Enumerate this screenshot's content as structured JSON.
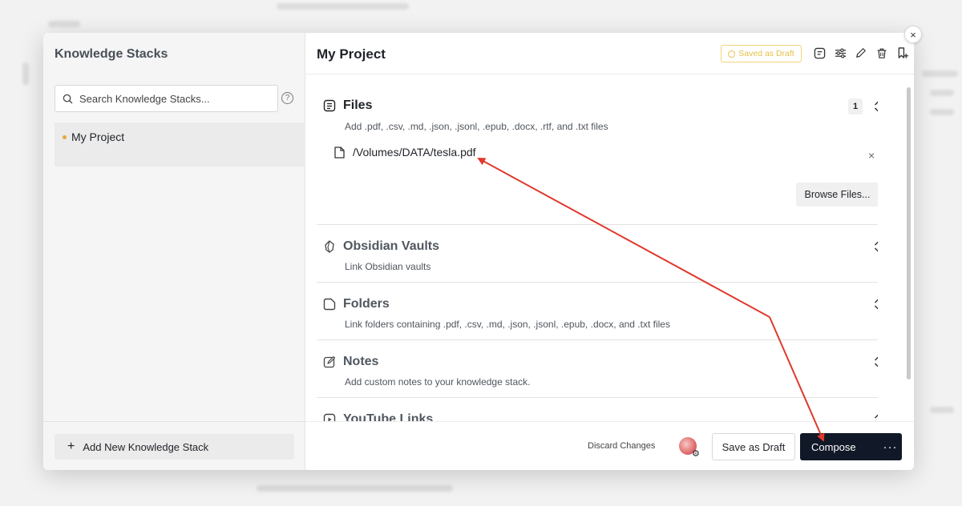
{
  "sidebar": {
    "title": "Knowledge Stacks",
    "search_placeholder": "Search Knowledge Stacks...",
    "help": "?",
    "items": [
      {
        "label": "My Project"
      }
    ],
    "add_button": "Add New Knowledge Stack"
  },
  "header": {
    "project_title": "My Project",
    "status_badge": "Saved as Draft"
  },
  "sections": {
    "files": {
      "title": "Files",
      "description": "Add .pdf, .csv, .md, .json, .jsonl, .epub, .docx, .rtf, and .txt files",
      "count": "1",
      "items": [
        {
          "path": "/Volumes/DATA/tesla.pdf"
        }
      ],
      "remove": "×",
      "browse_button": "Browse Files..."
    },
    "obsidian": {
      "title": "Obsidian Vaults",
      "description": "Link Obsidian vaults"
    },
    "folders": {
      "title": "Folders",
      "description": "Link folders containing .pdf, .csv, .md, .json, .jsonl, .epub, .docx, and .txt files"
    },
    "notes": {
      "title": "Notes",
      "description": "Add custom notes to your knowledge stack."
    },
    "youtube": {
      "title": "YouTube Links"
    }
  },
  "footer": {
    "discard": "Discard Changes",
    "save_draft": "Save as Draft",
    "compose": "Compose",
    "more": "···"
  },
  "colors": {
    "accent_dark": "#111827",
    "draft_yellow": "#e5c04a",
    "annotation_red": "#e0392b",
    "item_dot": "#e8a73a"
  },
  "close": "×"
}
